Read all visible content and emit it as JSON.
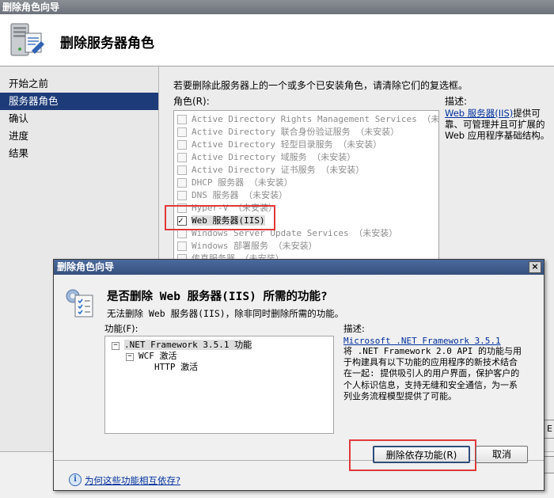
{
  "window": {
    "title": "删除角色向导"
  },
  "header": {
    "title": "删除服务器角色",
    "icon": "server-wizard-icon"
  },
  "nav": {
    "items": [
      {
        "label": "开始之前",
        "active": false
      },
      {
        "label": "服务器角色",
        "active": true
      },
      {
        "label": "确认",
        "active": false
      },
      {
        "label": "进度",
        "active": false
      },
      {
        "label": "结果",
        "active": false
      }
    ]
  },
  "main": {
    "instruction": "若要删除此服务器上的一个或多个已安装角色，请清除它们的复选框。",
    "roles_label": "角色(R):",
    "roles": [
      {
        "label": "Active Directory Rights Management Services  （未安装）",
        "checked": false
      },
      {
        "label": "Active Directory 联合身份验证服务  （未安装）",
        "checked": false
      },
      {
        "label": "Active Directory 轻型目录服务  （未安装）",
        "checked": false
      },
      {
        "label": "Active Directory 域服务  （未安装）",
        "checked": false
      },
      {
        "label": "Active Directory 证书服务  （未安装）",
        "checked": false
      },
      {
        "label": "DHCP 服务器  （未安装）",
        "checked": false
      },
      {
        "label": "DNS 服务器  （未安装）",
        "checked": false
      },
      {
        "label": "Hyper-V  （未安装）",
        "checked": false
      },
      {
        "label": "Web 服务器(IIS)",
        "checked": true
      },
      {
        "label": "Windows Server Update Services  （未安装）",
        "checked": false
      },
      {
        "label": "Windows 部署服务  （未安装）",
        "checked": false
      },
      {
        "label": "传真服务器  （未安装）",
        "checked": false
      }
    ],
    "desc_label": "描述:",
    "desc_link": "Web 服务器(IIS)",
    "desc_text": "提供可靠、可管理并且可扩展的 Web 应用程序基础结构。",
    "peek_button": "E"
  },
  "dialog": {
    "title": "删除角色向导",
    "close": "×",
    "heading": "是否删除 Web 服务器(IIS) 所需的功能?",
    "subtext": "无法删除 Web 服务器(IIS)，除非同时删除所需的功能。",
    "features_label": "功能(F):",
    "tree": [
      {
        "label": ".NET Framework 3.5.1 功能",
        "toggle": "−",
        "selected": true
      },
      {
        "label": "WCF 激活",
        "toggle": "−",
        "selected": false
      },
      {
        "label": "HTTP 激活",
        "toggle": "",
        "selected": false
      }
    ],
    "desc_label": "描述:",
    "desc_link": "Microsoft .NET Framework 3.5.1",
    "desc_text": "将 .NET Framework 2.0 API 的功能与用于构建具有以下功能的应用程序的新技术结合在一起: 提供吸引人的用户界面，保护客户的个人标识信息，支持无缝和安全通信，为一系列业务流程模型提供了可能。",
    "remove_button": "删除依存功能(R)",
    "cancel_button": "取消",
    "help_link": "为何这些功能相互依存?"
  },
  "colors": {
    "highlight": "#e0393b",
    "nav_active": "#1d3b78",
    "link": "#00309c"
  }
}
